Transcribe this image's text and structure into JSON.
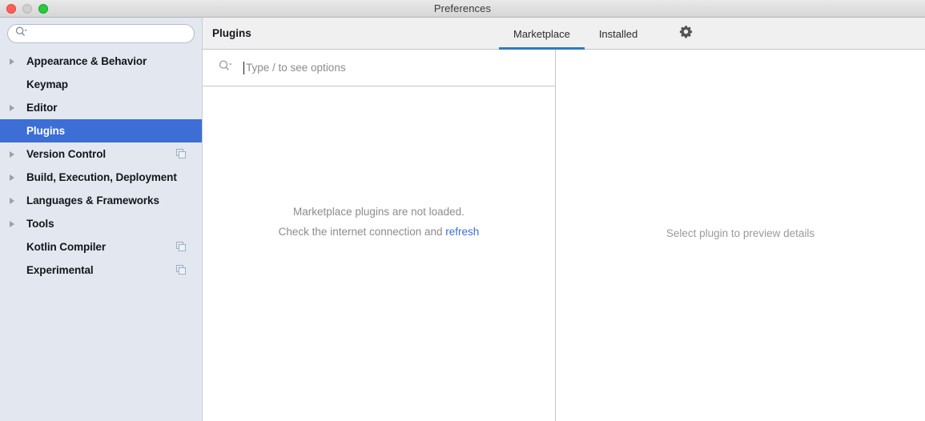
{
  "window": {
    "title": "Preferences",
    "traffic_lights": [
      "close-button",
      "minimize-button",
      "zoom-button"
    ]
  },
  "sidebar": {
    "search": {
      "value": "",
      "placeholder": ""
    },
    "items": [
      {
        "label": "Appearance & Behavior",
        "expandable": true,
        "selected": false,
        "trailing_icon": null
      },
      {
        "label": "Keymap",
        "expandable": false,
        "selected": false,
        "trailing_icon": null
      },
      {
        "label": "Editor",
        "expandable": true,
        "selected": false,
        "trailing_icon": null
      },
      {
        "label": "Plugins",
        "expandable": false,
        "selected": true,
        "trailing_icon": null
      },
      {
        "label": "Version Control",
        "expandable": true,
        "selected": false,
        "trailing_icon": "copy-icon"
      },
      {
        "label": "Build, Execution, Deployment",
        "expandable": true,
        "selected": false,
        "trailing_icon": null
      },
      {
        "label": "Languages & Frameworks",
        "expandable": true,
        "selected": false,
        "trailing_icon": null
      },
      {
        "label": "Tools",
        "expandable": true,
        "selected": false,
        "trailing_icon": null
      },
      {
        "label": "Kotlin Compiler",
        "expandable": false,
        "selected": false,
        "trailing_icon": "copy-icon"
      },
      {
        "label": "Experimental",
        "expandable": false,
        "selected": false,
        "trailing_icon": "copy-icon"
      }
    ]
  },
  "main": {
    "title": "Plugins",
    "tabs": [
      {
        "label": "Marketplace",
        "active": true
      },
      {
        "label": "Installed",
        "active": false
      }
    ],
    "settings_icon": "gear-icon",
    "plugin_search": {
      "value": "",
      "placeholder": "Type / to see options",
      "icon": "search-icon"
    },
    "empty_state": {
      "line1": "Marketplace plugins are not loaded.",
      "line2_prefix": "Check the internet connection and ",
      "line2_link": "refresh"
    },
    "preview": {
      "placeholder": "Select plugin to preview details"
    }
  },
  "colors": {
    "sidebar_bg": "#e3e7ef",
    "selection_blue": "#3c6ed5",
    "tab_underline": "#2d7cc4",
    "link_blue": "#3b6fd4",
    "header_bg": "#f0f0f0",
    "muted_text": "#8c8c8c"
  }
}
